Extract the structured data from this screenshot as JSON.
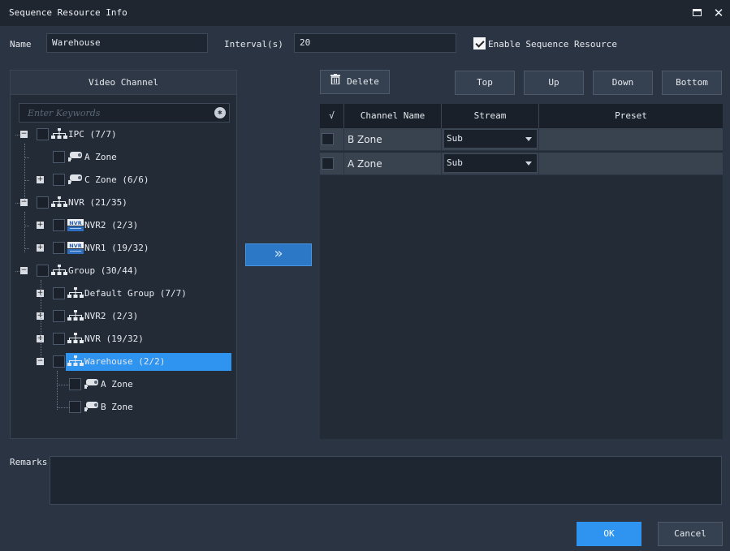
{
  "window": {
    "title": "Sequence Resource Info"
  },
  "form": {
    "name_label": "Name",
    "name_value": "Warehouse",
    "interval_label": "Interval(s)",
    "interval_value": "20",
    "enable_label": "Enable Sequence Resource",
    "enable_checked": true
  },
  "video_channel": {
    "header": "Video Channel",
    "search_placeholder": "Enter Keywords",
    "tree": [
      {
        "label": "IPC (7/7)",
        "icon": "network-icon",
        "level": 0,
        "expander": "-"
      },
      {
        "label": "A Zone",
        "icon": "camera-icon",
        "level": 1,
        "expander": ""
      },
      {
        "label": "C Zone (6/6)",
        "icon": "camera-icon",
        "level": 1,
        "expander": "+"
      },
      {
        "label": "NVR (21/35)",
        "icon": "network-icon",
        "level": 0,
        "expander": "-"
      },
      {
        "label": "NVR2 (2/3)",
        "icon": "nvr-icon",
        "level": 1,
        "expander": "+"
      },
      {
        "label": "NVR1 (19/32)",
        "icon": "nvr-icon",
        "level": 1,
        "expander": "+"
      },
      {
        "label": "Group (30/44)",
        "icon": "network-icon",
        "level": 0,
        "expander": "-"
      },
      {
        "label": "Default Group (7/7)",
        "icon": "network-icon",
        "level": 1,
        "expander": "+"
      },
      {
        "label": "NVR2 (2/3)",
        "icon": "network-icon",
        "level": 1,
        "expander": "+"
      },
      {
        "label": "NVR (19/32)",
        "icon": "network-icon",
        "level": 1,
        "expander": "+"
      },
      {
        "label": "Warehouse (2/2)",
        "icon": "network-icon",
        "level": 1,
        "expander": "-",
        "selected": true
      },
      {
        "label": "A Zone",
        "icon": "camera-icon",
        "level": 2,
        "expander": ""
      },
      {
        "label": "B Zone",
        "icon": "camera-icon",
        "level": 2,
        "expander": ""
      }
    ]
  },
  "move_button": {
    "glyph": "»"
  },
  "toolbar": {
    "delete_label": "Delete",
    "top_label": "Top",
    "up_label": "Up",
    "down_label": "Down",
    "bottom_label": "Bottom"
  },
  "table": {
    "headers": {
      "check": "√",
      "name": "Channel Name",
      "stream": "Stream",
      "preset": "Preset"
    },
    "rows": [
      {
        "name": "B Zone",
        "stream": "Sub",
        "preset": ""
      },
      {
        "name": "A Zone",
        "stream": "Sub",
        "preset": ""
      }
    ]
  },
  "remarks": {
    "label": "Remarks",
    "value": ""
  },
  "footer": {
    "ok_label": "OK",
    "cancel_label": "Cancel"
  },
  "colors": {
    "accent": "#2f93f0",
    "background": "#2b3442",
    "titlebar": "#1f2630"
  }
}
